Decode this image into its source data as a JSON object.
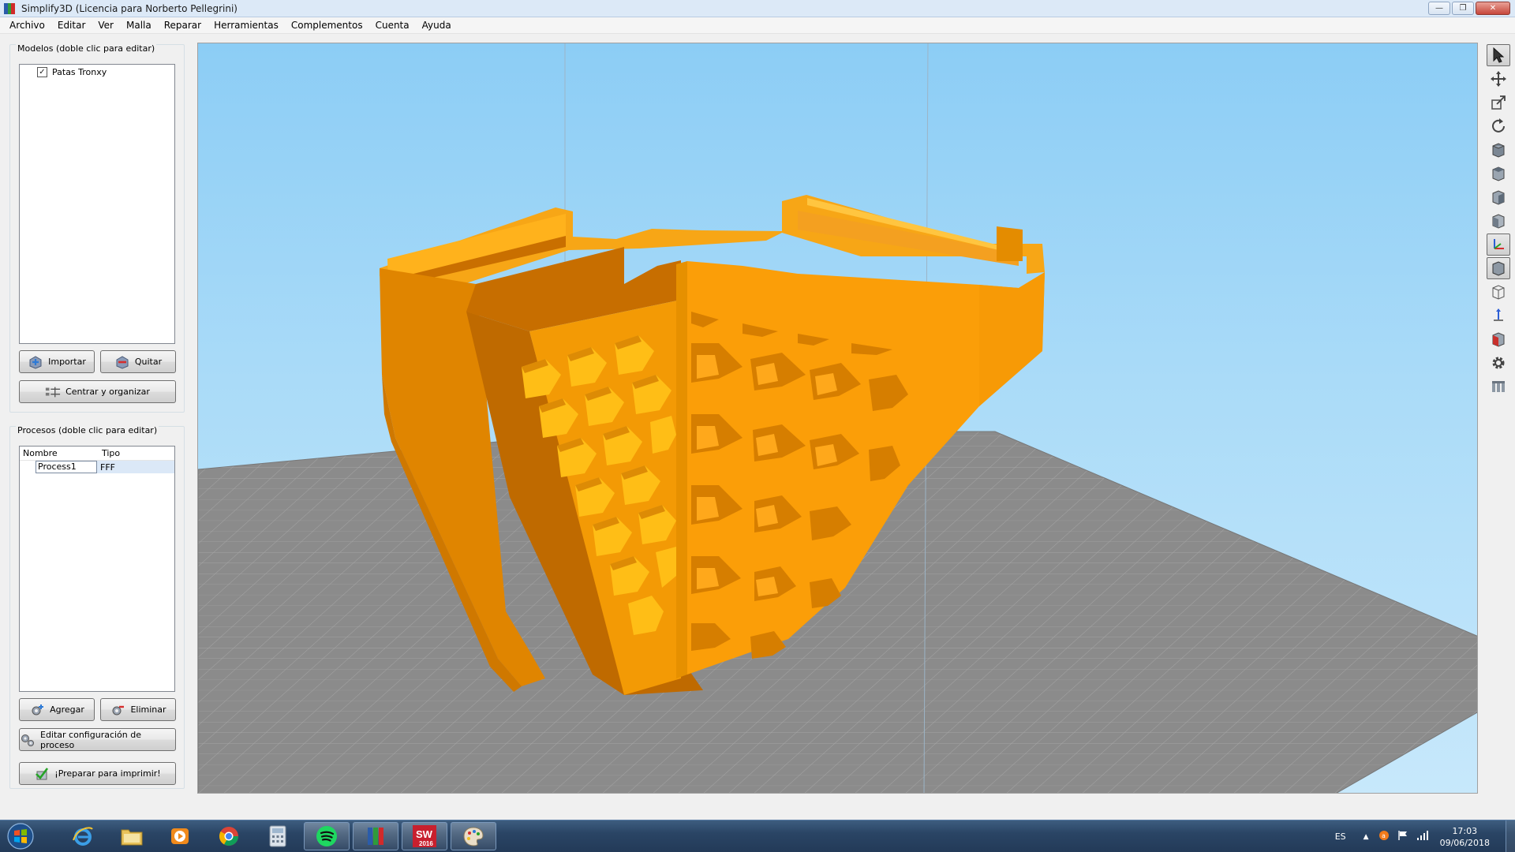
{
  "window": {
    "title": "Simplify3D (Licencia para Norberto Pellegrini)",
    "minimize": "—",
    "maximize": "❐",
    "close": "✕"
  },
  "menu": [
    "Archivo",
    "Editar",
    "Ver",
    "Malla",
    "Reparar",
    "Herramientas",
    "Complementos",
    "Cuenta",
    "Ayuda"
  ],
  "models": {
    "title": "Modelos (doble clic para editar)",
    "items": [
      {
        "label": "Patas Tronxy",
        "checked": true
      }
    ],
    "import_label": "Importar",
    "remove_label": "Quitar",
    "center_label": "Centrar y organizar"
  },
  "processes": {
    "title": "Procesos (doble clic para editar)",
    "col_name": "Nombre",
    "col_type": "Tipo",
    "rows": [
      {
        "name": "Process1",
        "type": "FFF"
      }
    ],
    "add_label": "Agregar",
    "delete_label": "Eliminar",
    "edit_label": "Editar configuración de proceso",
    "prepare_label": "¡Preparar para imprimir!"
  },
  "toolbar_tools": [
    "select-tool",
    "move-tool",
    "scale-tool",
    "rotate-tool",
    "view-front",
    "view-top",
    "view-side",
    "view-iso",
    "axes-toggle",
    "solid-view",
    "wireframe-view",
    "normals-view",
    "section-view",
    "settings-gear",
    "machine-toggle"
  ],
  "taskbar": {
    "language": "ES",
    "time": "17:03",
    "date": "09/06/2018",
    "apps": [
      "internet-explorer",
      "file-explorer",
      "media-player",
      "chrome",
      "calculator",
      "spotify",
      "simplify3d",
      "solidworks",
      "paint"
    ],
    "solidworks_badge": "2016"
  },
  "colors": {
    "model": "#f59a0a",
    "model_dark": "#c06e00",
    "model_light": "#ffc21a",
    "bed": "#8a8a8a",
    "sky": "#a9dbf8"
  }
}
